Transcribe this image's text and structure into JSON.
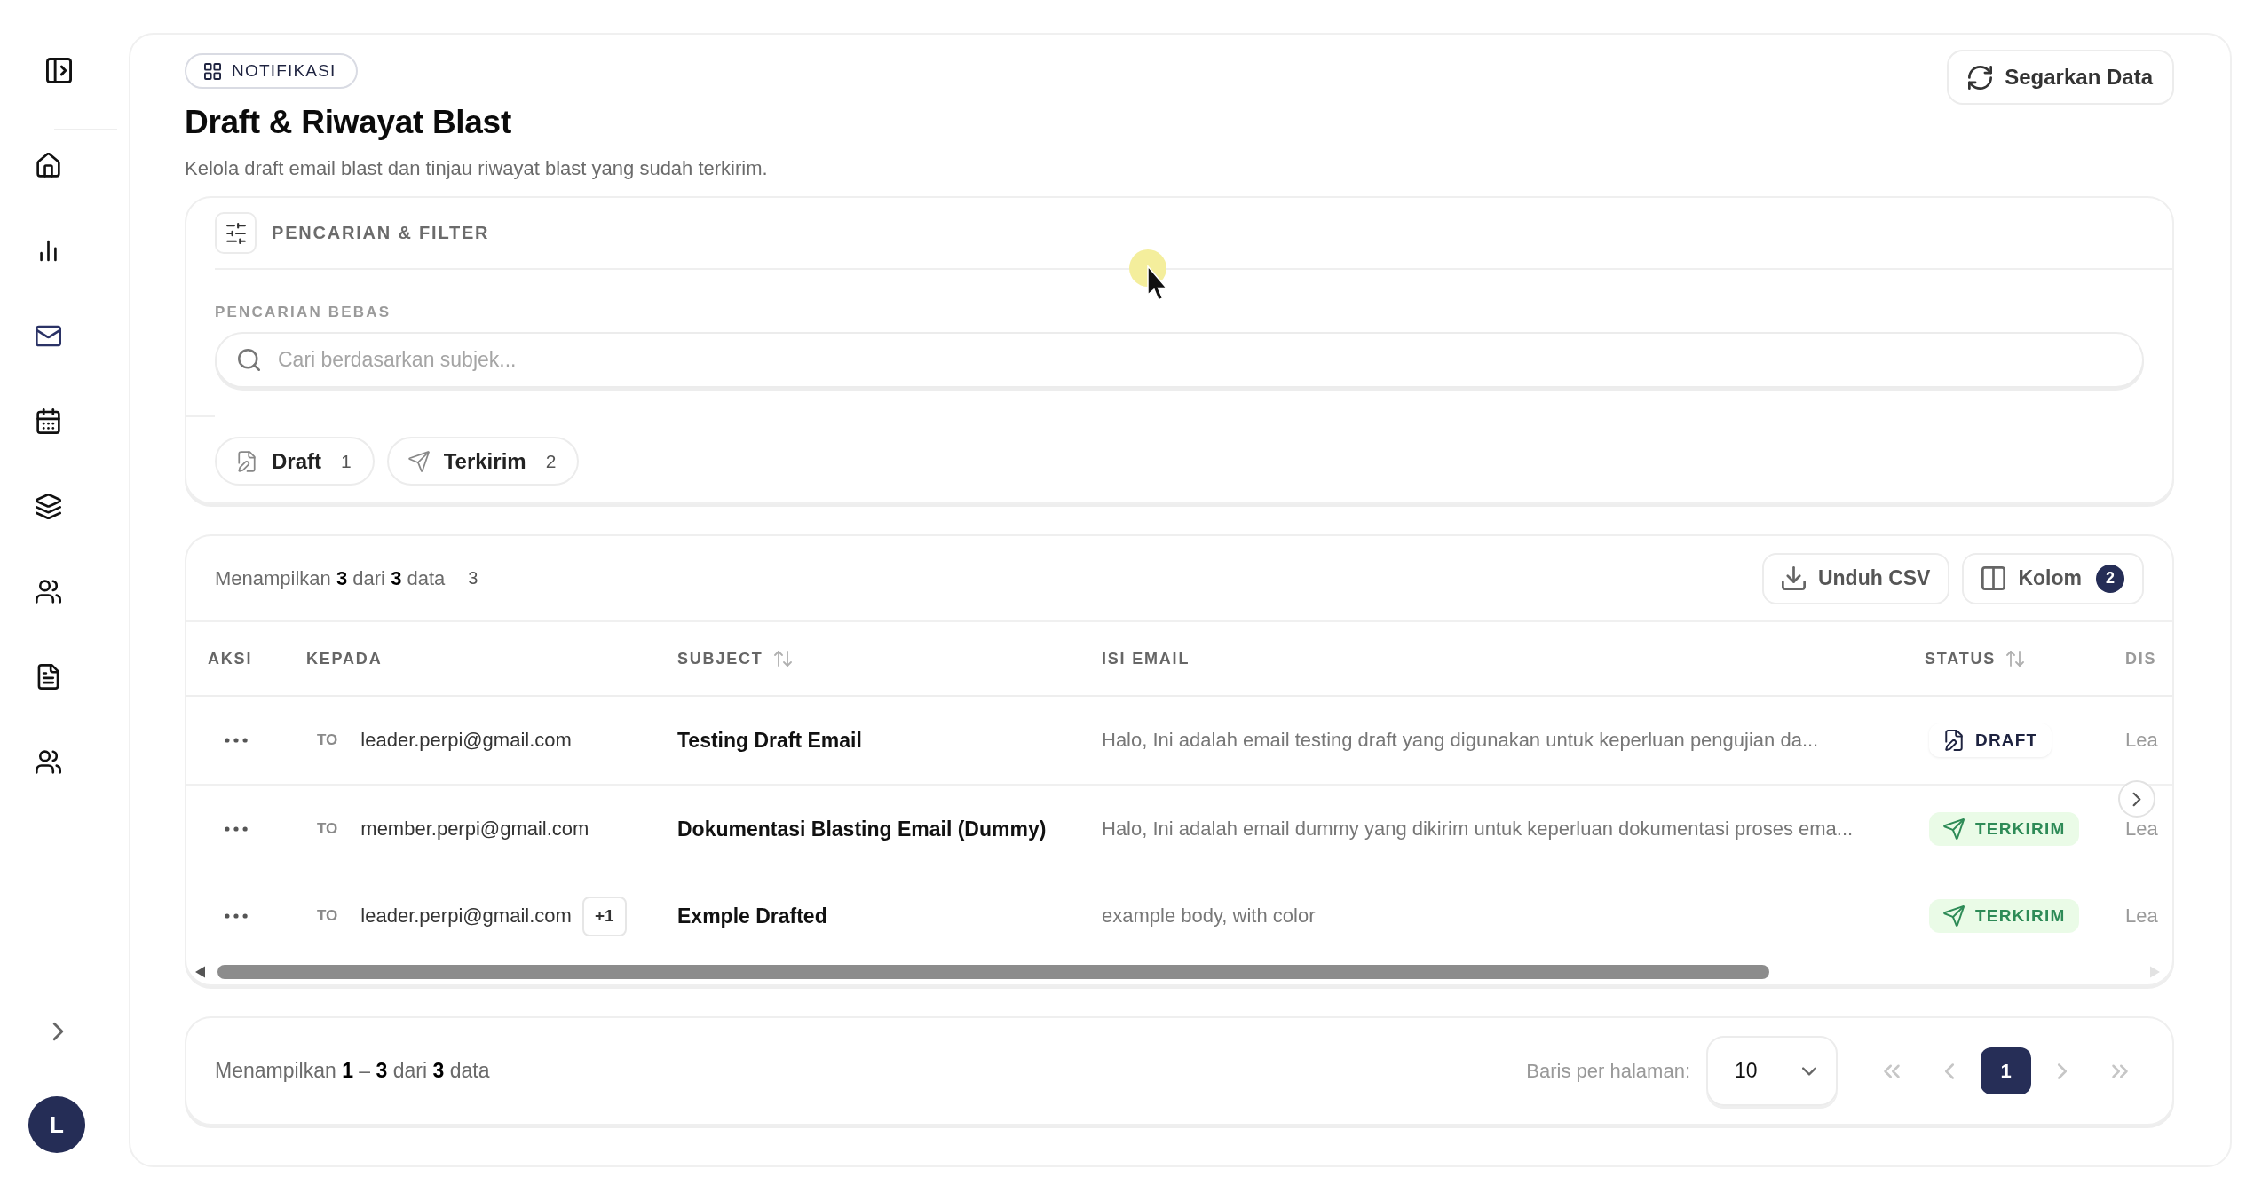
{
  "sidebar": {
    "items": [
      {
        "kind": "home",
        "selected": false
      },
      {
        "kind": "chart",
        "selected": false
      },
      {
        "kind": "mail",
        "selected": true
      },
      {
        "kind": "calendar",
        "selected": false
      },
      {
        "kind": "layers",
        "selected": false
      },
      {
        "kind": "users",
        "selected": false
      },
      {
        "kind": "document",
        "selected": false
      },
      {
        "kind": "users",
        "selected": false
      }
    ],
    "avatar": {
      "initial": "L"
    }
  },
  "header": {
    "badge": "NOTIFIKASI",
    "title": "Draft & Riwayat Blast",
    "subtitle": "Kelola draft email blast dan tinjau riwayat blast yang sudah terkirim.",
    "refresh_button": "Segarkan Data"
  },
  "filter": {
    "title": "PENCARIAN & FILTER",
    "search_label": "PENCARIAN BEBAS",
    "search": {
      "placeholder": "Cari berdasarkan subjek..."
    },
    "chips": [
      {
        "kind": "draft",
        "label": "Draft",
        "count": "1",
        "selected": false
      },
      {
        "kind": "sent",
        "label": "Terkirim",
        "count": "2",
        "selected": false
      }
    ]
  },
  "table": {
    "summary": "Menampilkan **3** dari **3** data",
    "count": "3",
    "buttons": [
      {
        "kind": "download",
        "label": "Unduh CSV"
      },
      {
        "kind": "columns",
        "label": "Kolom",
        "badge": "2"
      }
    ],
    "columns": [
      {
        "label": "AKSI",
        "sortable": false
      },
      {
        "label": "KEPADA",
        "sortable": false
      },
      {
        "label": "SUBJECT",
        "sortable": true
      },
      {
        "label": "ISI EMAIL",
        "sortable": false
      },
      {
        "label": "STATUS",
        "sortable": true
      },
      {
        "label": "DIS",
        "sortable": false
      }
    ],
    "rows": [
      {
        "to": "TO",
        "recipient": "leader.perpi@gmail.com",
        "subject": "Testing Draft Email",
        "body": "Halo, Ini adalah email testing draft yang digunakan untuk keperluan pengujian da...",
        "status": {
          "kind": "draft",
          "label": "DRAFT"
        },
        "column_6": "Lea"
      },
      {
        "to": "TO",
        "recipient": "member.perpi@gmail.com",
        "subject": "Dokumentasi Blasting Email (Dummy)",
        "body": "Halo, Ini adalah email dummy yang dikirim untuk keperluan dokumentasi proses ema...",
        "status": {
          "kind": "sent",
          "label": "TERKIRIM"
        },
        "column_6": "Lea"
      },
      {
        "to": "TO",
        "recipient": "leader.perpi@gmail.com",
        "extra": "+1",
        "subject": "Exmple Drafted",
        "body": "example body, with color",
        "status": {
          "kind": "sent",
          "label": "TERKIRIM"
        },
        "column_6": "Lea"
      }
    ]
  },
  "pagination": {
    "summary": "Menampilkan **1** – **3** dari **3** data",
    "per_page_label": "Baris per halaman:",
    "per_page": "10",
    "nav_before": [
      {
        "kind": "first",
        "disabled": true
      },
      {
        "kind": "prev",
        "disabled": true
      }
    ],
    "pages": [
      {
        "label": "1",
        "selected": true
      }
    ],
    "nav_after": [
      {
        "kind": "next",
        "disabled": true
      },
      {
        "kind": "last",
        "disabled": true
      }
    ]
  }
}
